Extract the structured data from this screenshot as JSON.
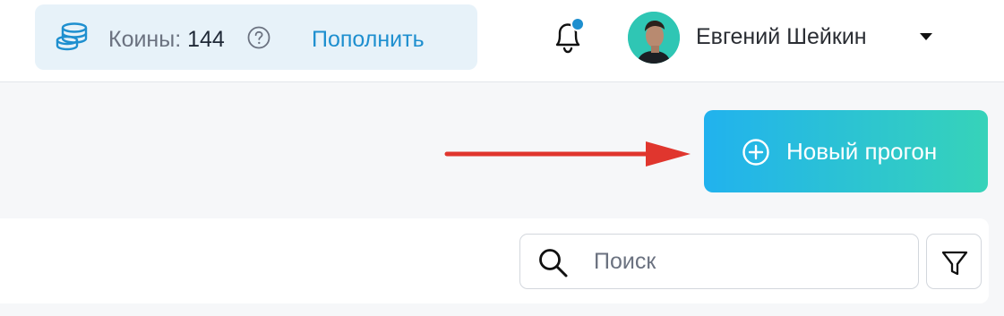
{
  "header": {
    "coins_label": "Коины:",
    "coins_value": "144",
    "topup_label": "Пополнить",
    "user_name": "Евгений Шейкин",
    "has_unread_notifications": true
  },
  "icons": {
    "coins": "coins-stack-icon",
    "help": "question-circle-icon",
    "notifications": "bell-icon",
    "dropdown": "caret-down-icon",
    "new_run": "plus-circle-icon",
    "search": "magnifier-icon",
    "filter": "funnel-icon"
  },
  "main": {
    "new_run_label": "Новый прогон",
    "search_placeholder": "Поиск"
  },
  "colors": {
    "accent": "#1e8fcf",
    "notification_dot": "#1e8fcf",
    "button_gradient_start": "#21b2ee",
    "button_gradient_end": "#36d3b9",
    "annotation_arrow": "#e0362e"
  }
}
